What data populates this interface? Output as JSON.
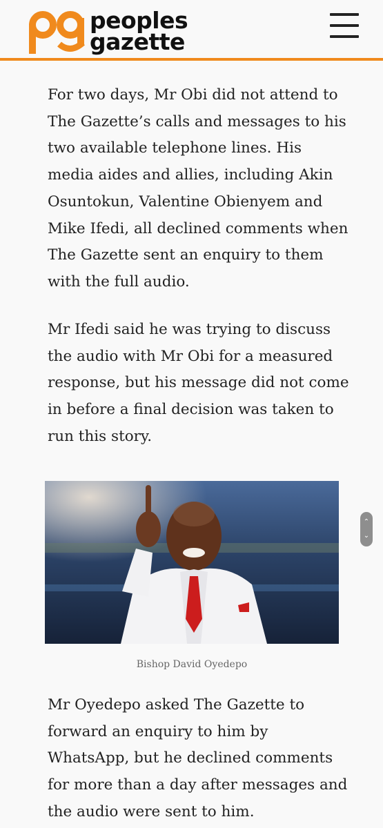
{
  "header": {
    "logo_monogram": "pg",
    "logo_line1": "peoples",
    "logo_line2": "gazette",
    "brand_color": "#f08a1d",
    "menu_icon": "hamburger-icon"
  },
  "article": {
    "paragraphs": [
      "For two days, Mr Obi did not attend to The Gazette’s calls and messages to his two available telephone lines. His media aides and allies, including Akin Osuntokun, Valentine Obienyem and Mike Ifedi, all declined comments when The Gazette sent an enquiry to them with the full audio.",
      "Mr Ifedi said he was trying to discuss the audio with Mr Obi for a measured response, but his message did not come in before a final decision was taken to run this story.",
      "Mr Oyedepo asked The Gazette to forward an enquiry to him by WhatsApp, but he declined comments for more than a day after messages and the audio were sent to him."
    ],
    "figure": {
      "caption": "Bishop David Oyedepo"
    }
  },
  "scroll_control": {
    "up_icon": "chevron-up-icon",
    "down_icon": "chevron-down-icon"
  }
}
